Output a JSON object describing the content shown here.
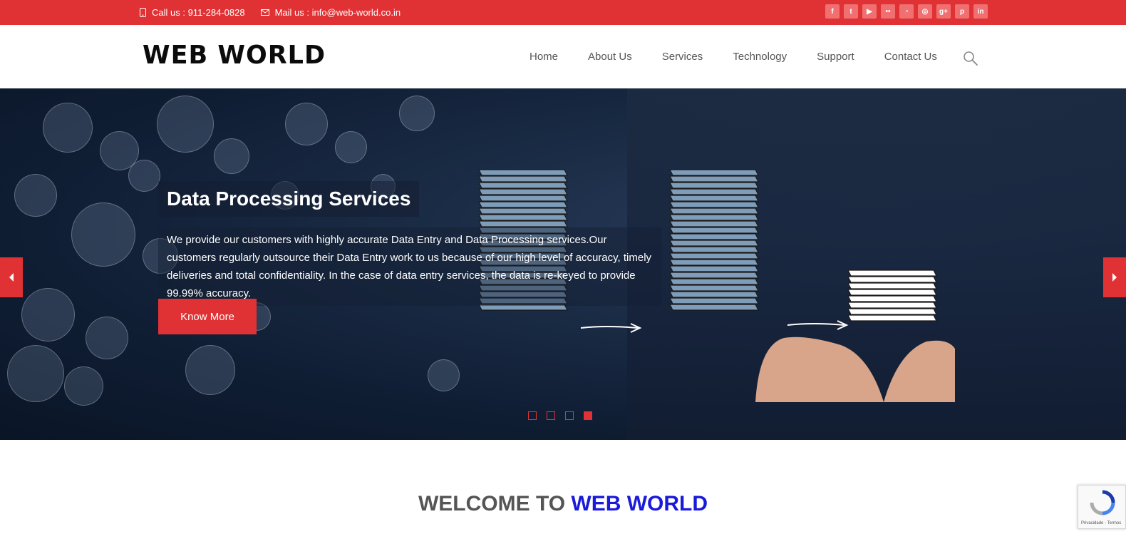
{
  "topbar": {
    "phone": "Call us : 911-284-0828",
    "mail": "Mail us : info@web-world.co.in",
    "socials": [
      {
        "icon": "facebook-icon",
        "glyph": "f"
      },
      {
        "icon": "twitter-icon",
        "glyph": "t"
      },
      {
        "icon": "youtube-icon",
        "glyph": "▶"
      },
      {
        "icon": "flickr-icon",
        "glyph": "••"
      },
      {
        "icon": "rss-icon",
        "glyph": "◔"
      },
      {
        "icon": "instagram-icon",
        "glyph": "◎"
      },
      {
        "icon": "google-plus-icon",
        "glyph": "g+"
      },
      {
        "icon": "pinterest-icon",
        "glyph": "p"
      },
      {
        "icon": "linkedin-icon",
        "glyph": "in"
      }
    ]
  },
  "header": {
    "logo": "WEB WORLD",
    "nav": [
      "Home",
      "About Us",
      "Services",
      "Technology",
      "Support",
      "Contact Us"
    ]
  },
  "hero": {
    "title": "Data Processing Services",
    "text": "We provide our customers with highly accurate Data Entry and Data Processing services.Our customers regularly outsource their Data Entry work to us because of our high level of accuracy, timely deliveries and total confidentiality. In the case of data entry services, the data is re-keyed to provide 99.99% accuracy.",
    "button": "Know More",
    "slide_count": 4,
    "active_slide": 4
  },
  "welcome": {
    "prefix": "WELCOME TO ",
    "brand": "WEB WORLD"
  },
  "recaptcha": {
    "text": "Privacidade - Termos"
  },
  "colors": {
    "accent": "#e03234",
    "brand_blue": "#1a1adb"
  }
}
